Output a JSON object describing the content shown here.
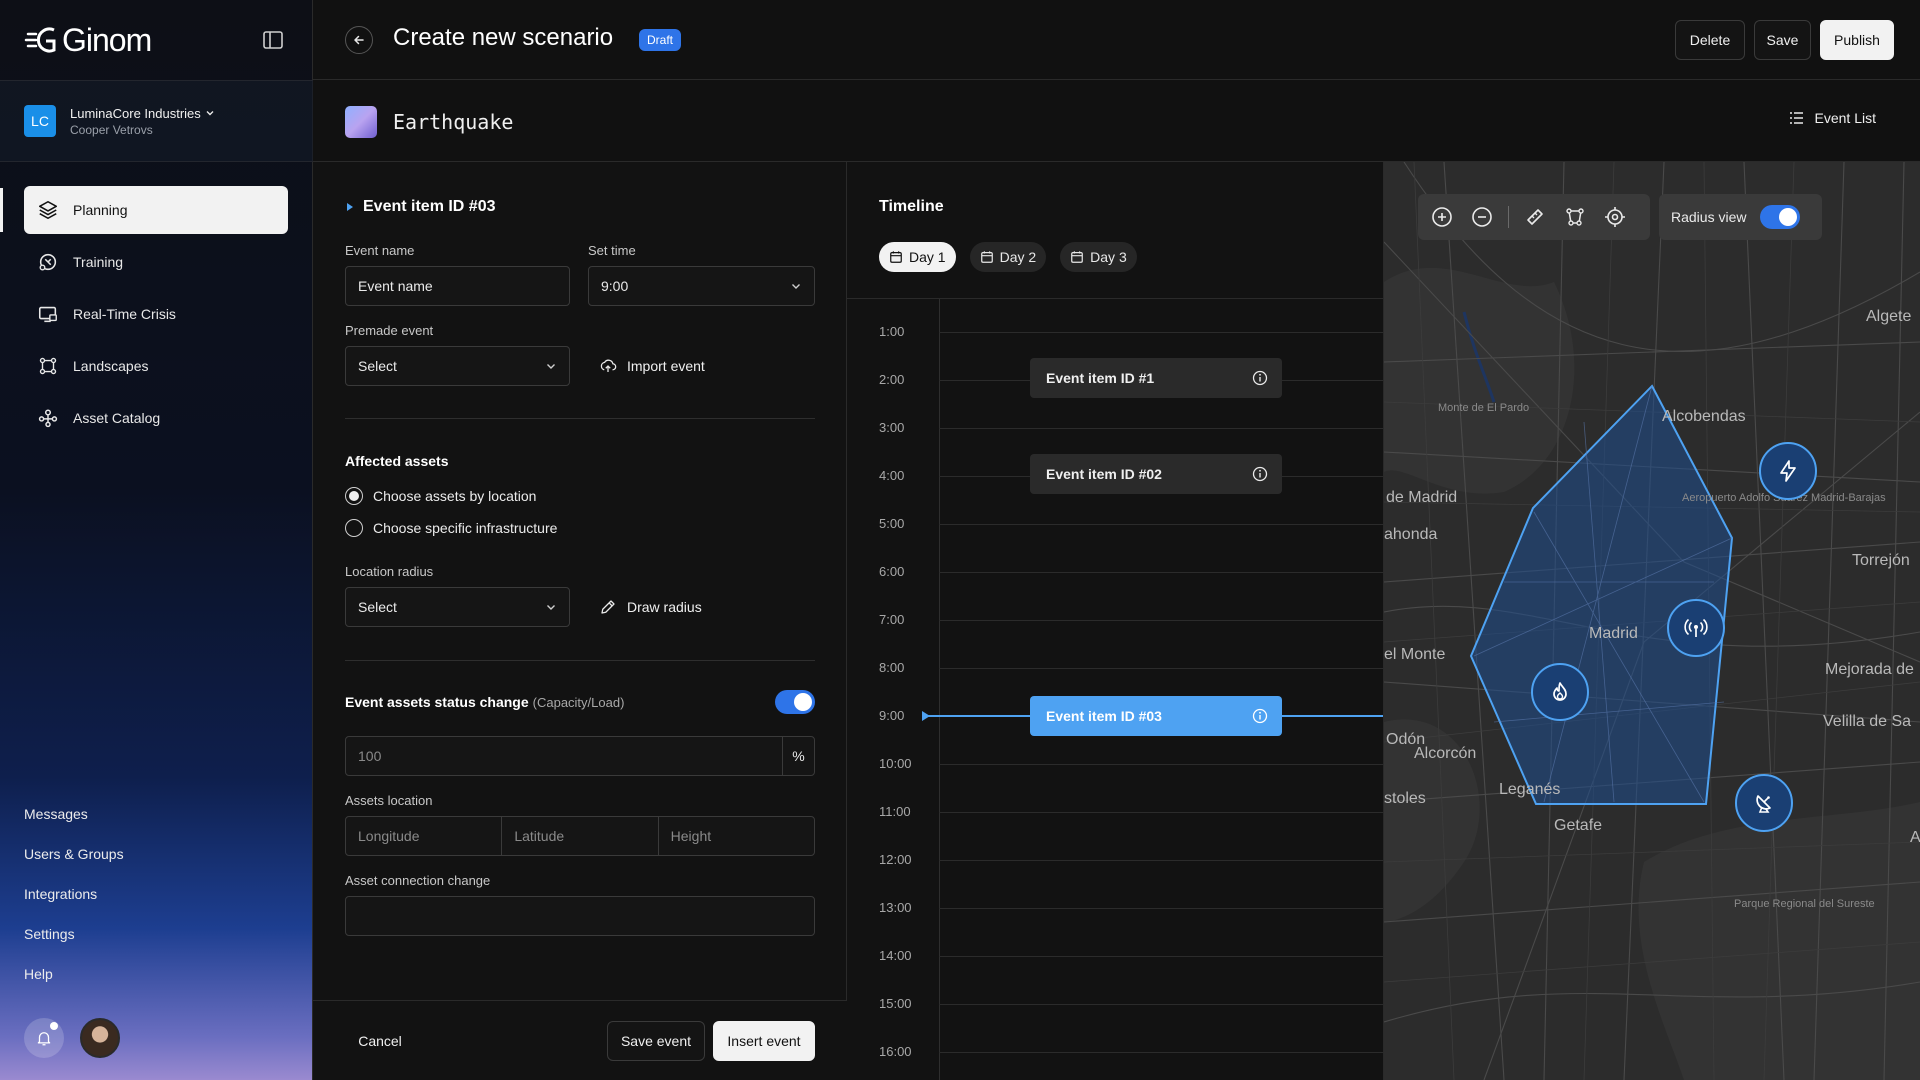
{
  "app": {
    "logo_text": "Ginom",
    "org": {
      "initials": "LC",
      "name": "LuminaCore Industries",
      "user": "Cooper Vetrovs"
    }
  },
  "nav": {
    "items": [
      {
        "label": "Planning",
        "icon": "layers-icon"
      },
      {
        "label": "Training",
        "icon": "training-icon"
      },
      {
        "label": "Real-Time Crisis",
        "icon": "monitor-icon"
      },
      {
        "label": "Landscapes",
        "icon": "landscape-icon"
      },
      {
        "label": "Asset Catalog",
        "icon": "asset-network-icon"
      }
    ],
    "active_index": 0,
    "bottom": [
      "Messages",
      "Users & Groups",
      "Integrations",
      "Settings",
      "Help"
    ]
  },
  "header": {
    "title": "Create new scenario",
    "badge": "Draft",
    "buttons": {
      "delete": "Delete",
      "save": "Save",
      "publish": "Publish"
    }
  },
  "subheader": {
    "scenario_name": "Earthquake",
    "event_list": "Event List"
  },
  "form": {
    "section_title": "Event item ID #03",
    "event_name": {
      "label": "Event name",
      "value": "Event name"
    },
    "set_time": {
      "label": "Set time",
      "value": "9:00"
    },
    "premade_event": {
      "label": "Premade event",
      "value": "Select"
    },
    "import_event": "Import event",
    "affected_assets": {
      "title": "Affected assets",
      "options": [
        "Choose assets by location",
        "Choose specific infrastructure"
      ],
      "selected": 0
    },
    "location_radius": {
      "label": "Location radius",
      "value": "Select"
    },
    "draw_radius": "Draw radius",
    "status_change": {
      "title": "Event assets status change",
      "subtitle": "(Capacity/Load)",
      "enabled": true
    },
    "capacity": {
      "placeholder": "100",
      "unit": "%"
    },
    "assets_location": {
      "label": "Assets location",
      "fields": [
        "Longitude",
        "Latitude",
        "Height"
      ]
    },
    "connection_change": {
      "label": "Asset connection change",
      "value": ""
    },
    "footer": {
      "cancel": "Cancel",
      "save_event": "Save event",
      "insert_event": "Insert event"
    }
  },
  "timeline": {
    "title": "Timeline",
    "days": [
      "Day 1",
      "Day 2",
      "Day 3"
    ],
    "active_day": 0,
    "hours": [
      "1:00",
      "2:00",
      "3:00",
      "4:00",
      "5:00",
      "6:00",
      "7:00",
      "8:00",
      "9:00",
      "10:00",
      "11:00",
      "12:00",
      "13:00",
      "14:00",
      "15:00",
      "16:00"
    ],
    "events": [
      {
        "label": "Event item ID #1",
        "hour": "2:00",
        "active": false
      },
      {
        "label": "Event item ID #02",
        "hour": "4:00",
        "active": false
      },
      {
        "label": "Event item ID #03",
        "hour": "9:00",
        "active": true
      }
    ],
    "current_time": "9:00"
  },
  "map": {
    "radius_view": {
      "label": "Radius view",
      "enabled": true
    },
    "tools": [
      "zoom-in-icon",
      "zoom-out-icon",
      "ruler-icon",
      "polygon-icon",
      "locate-icon"
    ],
    "labels": {
      "algete": "Algete",
      "monte_pardo": "Monte de El Pardo",
      "alcobendas": "Alcobendas",
      "airport": "Aeropuerto Adolfo Suárez Madrid-Barajas",
      "de_madrid": "de Madrid",
      "ahonda": "ahonda",
      "torrejon": "Torrejón",
      "madrid": "Madrid",
      "el_monte": "el Monte",
      "mejorada": "Mejorada de",
      "velilla": "Velilla de Sa",
      "odon": "Odón",
      "alcorcon": "Alcorcón",
      "leganes": "Leganés",
      "stoles": "stoles",
      "getafe": "Getafe",
      "parque": "Parque Regional del Sureste",
      "a": "A"
    },
    "markers": [
      "lightning-icon",
      "antenna-icon",
      "fire-icon",
      "satellite-dish-icon"
    ],
    "colors": {
      "accent": "#4ea2f2",
      "zone_fill": "#1f4f90"
    }
  }
}
